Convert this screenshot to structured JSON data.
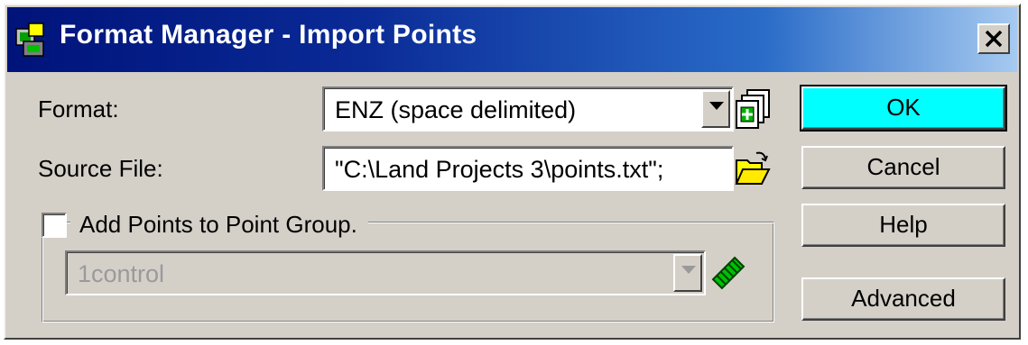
{
  "window": {
    "title": "Format Manager - Import Points",
    "app_icon": "format-manager-icon",
    "close_icon": "close-icon"
  },
  "form": {
    "format_label": "Format:",
    "format_value": "ENZ (space delimited)",
    "format_manage_icon": "manage-formats-icon",
    "source_label": "Source File:",
    "source_value": "\"C:\\Land Projects 3\\points.txt\";",
    "source_browse_icon": "folder-open-icon",
    "add_to_group_label": "Add Points to Point Group.",
    "add_to_group_checked": false,
    "group_value": "1control",
    "group_icon": "point-group-icon"
  },
  "buttons": {
    "ok": "OK",
    "cancel": "Cancel",
    "help": "Help",
    "advanced": "Advanced"
  },
  "colors": {
    "title_start": "#00137a",
    "title_end": "#a6caf0",
    "default_button": "#00ffff",
    "face": "#d4d0c8"
  }
}
